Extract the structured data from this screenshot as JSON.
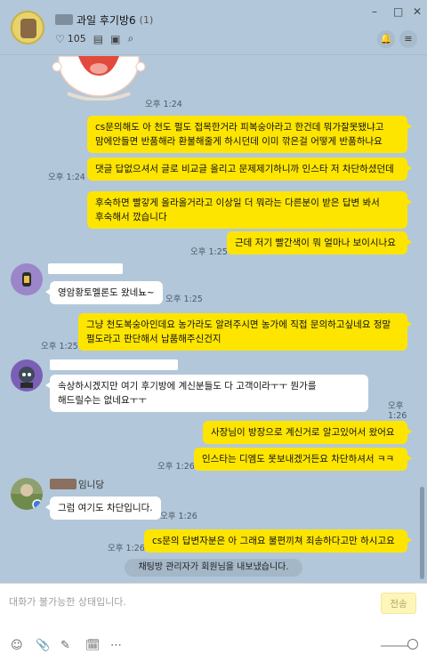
{
  "room": {
    "title": "과일 후기방6",
    "count": "(1)",
    "likes": "105"
  },
  "window": {
    "minimize": "–",
    "maximize": "□",
    "close": "✕"
  },
  "icons": {
    "heart": "♡",
    "notes": "▤",
    "album": "▣",
    "search": "⌕",
    "bell": "🔔",
    "menu": "≡",
    "emoji": "☺",
    "attach": "📎",
    "pen": "✎",
    "gift": "🗓",
    "more": "⋯"
  },
  "messages": [
    {
      "id": "sticker-time",
      "time": "오후 1:24"
    },
    {
      "id": "m1",
      "text": "cs문의해도 아 천도 펄도 접목한거라 피복숭아라고 한건데 뭐가잘못됐냐고 맘에안들면 반품해라 환불해줄게 하시던데 이미 깎은걸 어떻게 반품하나요",
      "time": ""
    },
    {
      "id": "m2",
      "text": "댓글 답없으셔서 글로 비교글 올리고 문제제기하니까 인스타 저 차단하셨던데",
      "time": "오후 1:24"
    },
    {
      "id": "m3",
      "text": "후숙하면 빨갛게 올라올거라고 이상일 더 뭐라는 다른분이 받은 답변 봐서 후숙해서 깠습니다",
      "time": ""
    },
    {
      "id": "m4",
      "text": "근데 저기 빨간색이 뭐 얼마나 보이시나요",
      "time": "오후 1:25"
    },
    {
      "id": "m5",
      "text": "영암황토멜론도 왔네뇨~",
      "time": "오후 1:25"
    },
    {
      "id": "m6",
      "text": "그냥 천도복숭아인데요 농가라도 알려주시면 농가에 직접 문의하고싶네요 정말 펄도라고 판단해서 납품해주신건지",
      "time": "오후 1:25"
    },
    {
      "id": "m7",
      "text": "속상하시겠지만 여기 후기방에 계신분들도 다 고객이라ㅜㅜ 뭔가를 해드릴수는 없네요ㅜㅜ",
      "time": "오후 1:26"
    },
    {
      "id": "m8",
      "text": "사장님이 방장으로 계신거로 알고있어서 왔어요",
      "time": ""
    },
    {
      "id": "m9",
      "text": "인스타는 디엠도 못보내겠거든요 차단하셔서 ㅋㅋ",
      "time": "오후 1:26"
    },
    {
      "id": "name3",
      "text": "임니당"
    },
    {
      "id": "m10",
      "text": "그럼 여기도 차단입니다.",
      "time": "오후 1:26"
    },
    {
      "id": "m11",
      "text": "cs문의 답변자분은 아 그래요 불편끼쳐 죄송하다고만 하시고요",
      "time": "오후 1:26"
    }
  ],
  "notice": "채팅방 관리자가 회원님을 내보냈습니다.",
  "input": {
    "placeholder": "대화가 불가능한 상태입니다.",
    "send_label": "전송"
  }
}
